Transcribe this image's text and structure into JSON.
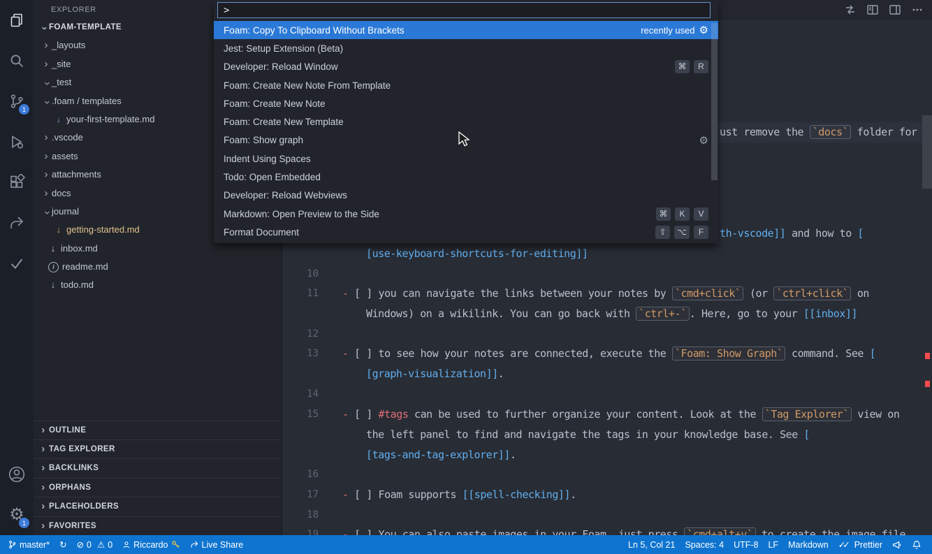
{
  "activity_bar": {
    "items": [
      {
        "name": "explorer"
      },
      {
        "name": "search"
      },
      {
        "name": "source-control",
        "badge": "1"
      },
      {
        "name": "run-and-debug"
      },
      {
        "name": "extensions"
      },
      {
        "name": "live-share"
      },
      {
        "name": "tests"
      }
    ],
    "bottom": [
      {
        "name": "accounts"
      },
      {
        "name": "settings",
        "badge": "1"
      }
    ]
  },
  "sidebar": {
    "title": "EXPLORER",
    "root_label": "FOAM-TEMPLATE",
    "tree": [
      {
        "label": "_layouts",
        "kind": "folder",
        "expanded": false
      },
      {
        "label": "_site",
        "kind": "folder",
        "expanded": false
      },
      {
        "label": "_test",
        "kind": "folder",
        "expanded": true
      },
      {
        "label": ".foam / templates",
        "kind": "folder",
        "expanded": true
      },
      {
        "label": "your-first-template.md",
        "kind": "file",
        "icon": "markdown-icon"
      },
      {
        "label": ".vscode",
        "kind": "folder",
        "expanded": false
      },
      {
        "label": "assets",
        "kind": "folder",
        "expanded": false
      },
      {
        "label": "attachments",
        "kind": "folder",
        "expanded": false
      },
      {
        "label": "docs",
        "kind": "folder",
        "expanded": false
      },
      {
        "label": "journal",
        "kind": "folder",
        "expanded": true
      },
      {
        "label": "getting-started.md",
        "kind": "file",
        "icon": "markdown-icon",
        "modified": true
      },
      {
        "label": "inbox.md",
        "kind": "file",
        "icon": "markdown-icon"
      },
      {
        "label": "readme.md",
        "kind": "file",
        "icon": "info-icon"
      },
      {
        "label": "todo.md",
        "kind": "file",
        "icon": "markdown-icon"
      }
    ],
    "sections": [
      {
        "label": "OUTLINE"
      },
      {
        "label": "TAG EXPLORER"
      },
      {
        "label": "BACKLINKS"
      },
      {
        "label": "ORPHANS"
      },
      {
        "label": "PLACEHOLDERS"
      },
      {
        "label": "FAVORITES"
      }
    ]
  },
  "palette": {
    "input_value": ">",
    "items": [
      {
        "label": "Foam: Copy To Clipboard Without Brackets",
        "meta": "recently used",
        "gear": true,
        "selected": true
      },
      {
        "label": "Jest: Setup Extension (Beta)"
      },
      {
        "label": "Developer: Reload Window",
        "keys": [
          "⌘",
          "R"
        ]
      },
      {
        "label": "Foam: Create New Note From Template"
      },
      {
        "label": "Foam: Create New Note"
      },
      {
        "label": "Foam: Create New Template"
      },
      {
        "label": "Foam: Show graph",
        "gear": true
      },
      {
        "label": "Indent Using Spaces"
      },
      {
        "label": "Todo: Open Embedded"
      },
      {
        "label": "Developer: Reload Webviews"
      },
      {
        "label": "Markdown: Open Preview to the Side",
        "keys": [
          "⌘",
          "K",
          "V"
        ]
      },
      {
        "label": "Format Document",
        "keys": [
          "⇧",
          "⌥",
          "F"
        ]
      }
    ]
  },
  "editor": {
    "gutter": [
      "10",
      "11",
      "12",
      "13",
      "14",
      "15",
      "16",
      "17",
      "18",
      "19"
    ],
    "lines": [
      {
        "segments": [
          {
            "type": "text",
            "text": "ust remove the "
          },
          {
            "type": "code",
            "text": "`docs`"
          },
          {
            "type": "text",
            "text": " folder for"
          }
        ]
      },
      {
        "segments": [
          {
            "type": "link",
            "text": "th-vscode]]"
          },
          {
            "type": "text",
            "text": " and how to "
          },
          {
            "type": "link",
            "text": "["
          }
        ]
      },
      {
        "segments": [
          {
            "type": "link",
            "text": "[use-keyboard-shortcuts-for-editing]]"
          }
        ]
      },
      {
        "segments": [
          {
            "type": "dash",
            "text": "-"
          },
          {
            "type": "text",
            "text": " [ ] you can navigate the links between your notes by "
          },
          {
            "type": "code",
            "text": "`cmd+click`"
          },
          {
            "type": "text",
            "text": " (or "
          },
          {
            "type": "code",
            "text": "`ctrl+click`"
          },
          {
            "type": "text",
            "text": " on"
          }
        ]
      },
      {
        "segments": [
          {
            "type": "text",
            "text": "Windows) on a wikilink. You can go back with "
          },
          {
            "type": "code",
            "text": "`ctrl+-`"
          },
          {
            "type": "text",
            "text": ". Here, go to your "
          },
          {
            "type": "link",
            "text": "[[inbox]]"
          }
        ]
      },
      {
        "segments": [
          {
            "type": "dash",
            "text": "-"
          },
          {
            "type": "text",
            "text": " [ ] to see how your notes are connected, execute the "
          },
          {
            "type": "code",
            "text": "`Foam: Show Graph`"
          },
          {
            "type": "text",
            "text": " command. See "
          },
          {
            "type": "link",
            "text": "["
          }
        ]
      },
      {
        "segments": [
          {
            "type": "link",
            "text": "[graph-visualization]]"
          },
          {
            "type": "text",
            "text": "."
          }
        ]
      },
      {
        "segments": [
          {
            "type": "dash",
            "text": "-"
          },
          {
            "type": "text",
            "text": " [ ] "
          },
          {
            "type": "tag",
            "text": "#tags"
          },
          {
            "type": "text",
            "text": " can be used to further organize your content. Look at the "
          },
          {
            "type": "code",
            "text": "`Tag Explorer`"
          },
          {
            "type": "text",
            "text": " view on"
          }
        ]
      },
      {
        "segments": [
          {
            "type": "text",
            "text": "the left panel to find and navigate the tags in your knowledge base. See "
          },
          {
            "type": "link",
            "text": "["
          }
        ]
      },
      {
        "segments": [
          {
            "type": "link",
            "text": "[tags-and-tag-explorer]]"
          },
          {
            "type": "text",
            "text": "."
          }
        ]
      },
      {
        "segments": [
          {
            "type": "dash",
            "text": "-"
          },
          {
            "type": "text",
            "text": " [ ] Foam supports "
          },
          {
            "type": "link",
            "text": "[[spell-checking]]"
          },
          {
            "type": "text",
            "text": "."
          }
        ]
      },
      {
        "segments": [
          {
            "type": "dash",
            "text": "-"
          },
          {
            "type": "text",
            "text": " [ ] You can also paste images in your Foam, just press "
          },
          {
            "type": "code",
            "text": "`cmd+alt+v`"
          },
          {
            "type": "text",
            "text": " to create the image file"
          }
        ]
      }
    ]
  },
  "status_bar": {
    "left": {
      "branch": "master*",
      "errors": "0",
      "warnings": "0",
      "user": "Riccardo",
      "live_share": "Live Share"
    },
    "right": {
      "position": "Ln 5, Col 21",
      "indent": "Spaces: 4",
      "encoding": "UTF-8",
      "eol": "LF",
      "language": "Markdown",
      "formatter": "Prettier"
    }
  },
  "colors": {
    "status_bar": "#0f74cf",
    "selection_blue": "#2b79d7",
    "modified_file": "#e2c08d",
    "error_marker": "#f14c4c",
    "code_span": "#d19a66",
    "wikilink": "#61afef",
    "list_dash": "#e06c75"
  }
}
